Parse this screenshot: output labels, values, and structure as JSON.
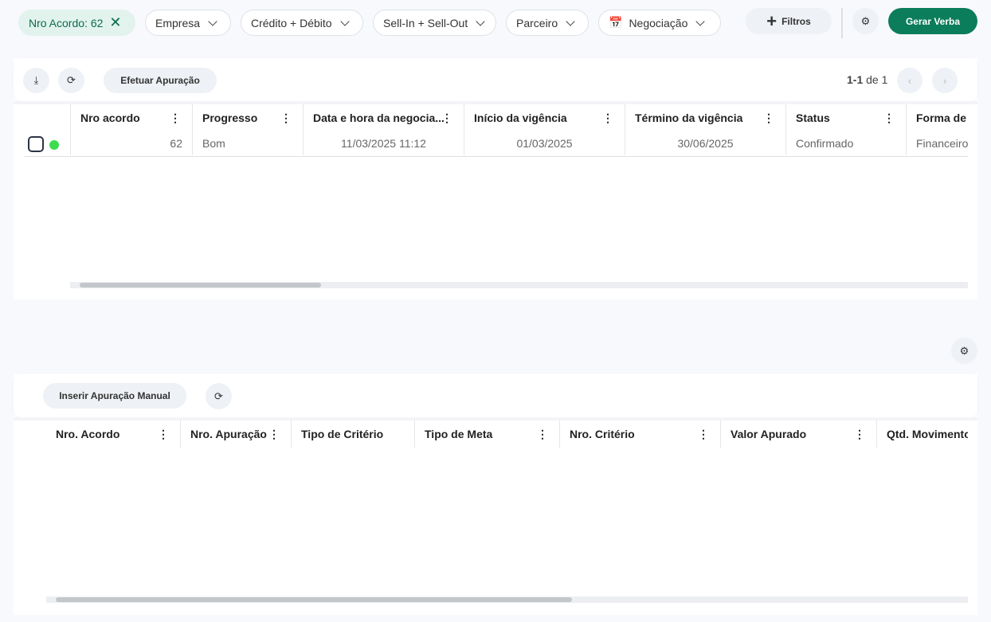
{
  "filters": {
    "active_chip": "Nro Acordo: 62",
    "chips": [
      "Empresa",
      "Crédito + Débito",
      "Sell-In + Sell-Out",
      "Parceiro",
      "Negociação"
    ],
    "filtros_label": "Filtros",
    "generate_label": "Gerar Verba",
    "accent": "#0b7d5a"
  },
  "agreements": {
    "apuracao_label": "Efetuar Apuração",
    "pagination": {
      "range": "1-1",
      "of": "de 1"
    },
    "columns": [
      "Nro acordo",
      "Progresso",
      "Data e hora da negocia...",
      "Início da vigência",
      "Término da vigência",
      "Status",
      "Forma de p"
    ],
    "rows": [
      {
        "nro": "62",
        "progresso": "Bom",
        "data": "11/03/2025 11:12",
        "inicio": "01/03/2025",
        "termino": "30/06/2025",
        "status": "Confirmado",
        "forma": "Financeiro",
        "status_color": "#3ddc50"
      }
    ]
  },
  "apuracoes": {
    "insert_label": "Inserir Apuração Manual",
    "columns": [
      "Nro. Acordo",
      "Nro. Apuração",
      "Tipo de Critério",
      "Tipo de Meta",
      "Nro. Critério",
      "Valor Apurado",
      "Qtd. Movimento"
    ]
  }
}
